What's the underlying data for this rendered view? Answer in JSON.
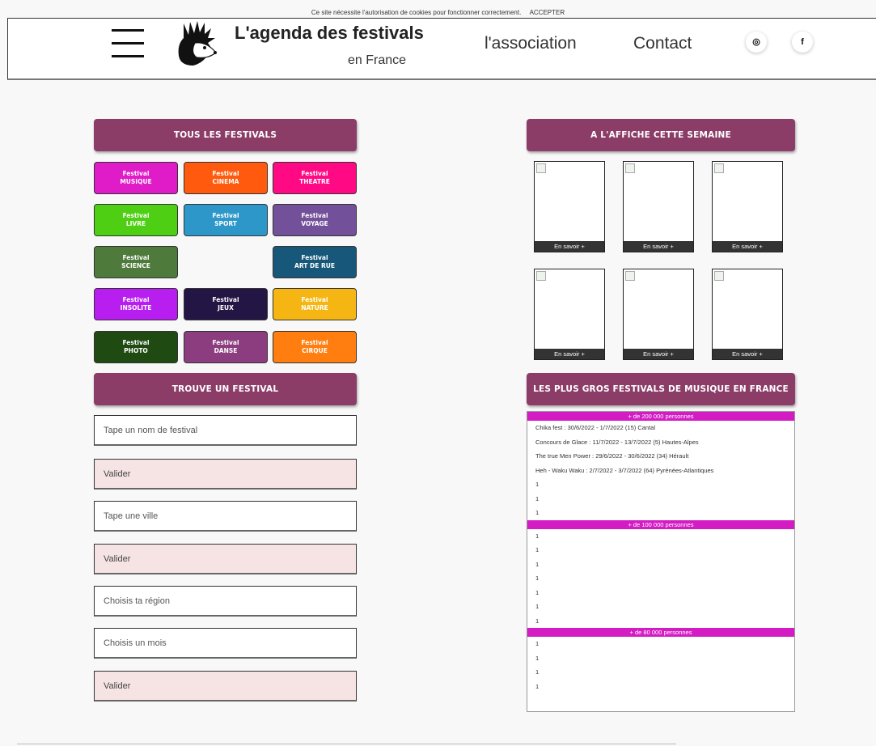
{
  "cookie_bar": {
    "message": "Ce site nécessite l'autorisation de cookies pour fonctionner correctement.",
    "accept_label": "ACCEPTER"
  },
  "header": {
    "title": "L'agenda des festivals",
    "subtitle": "en France",
    "nav": {
      "association": "l'association",
      "contact": "Contact"
    },
    "social": {
      "instagram_glyph": "◎",
      "facebook_glyph": "f"
    }
  },
  "left": {
    "all_festivals_title": "TOUS LES FESTIVALS",
    "categories": [
      {
        "line1": "Festival",
        "line2": "MUSIQUE",
        "color": "#e01bc8"
      },
      {
        "line1": "Festival",
        "line2": "CINEMA",
        "color": "#ff5a0d"
      },
      {
        "line1": "Festival",
        "line2": "THEATRE",
        "color": "#ff0a84"
      },
      {
        "line1": "Festival",
        "line2": "LIVRE",
        "color": "#4fcf14"
      },
      {
        "line1": "Festival",
        "line2": "SPORT",
        "color": "#2e97c9"
      },
      {
        "line1": "Festival",
        "line2": "VOYAGE",
        "color": "#73519a"
      },
      {
        "line1": "Festival",
        "line2": "SCIENCE",
        "color": "#4e7a3b"
      },
      {
        "line1": "Festival",
        "line2": "ART DE RUE",
        "color": "#17587a"
      },
      {
        "line1": "Festival",
        "line2": "INSOLITE",
        "color": "#b71eef"
      },
      {
        "line1": "Festival",
        "line2": "JEUX",
        "color": "#231644"
      },
      {
        "line1": "Festival",
        "line2": "NATURE",
        "color": "#f5b614"
      },
      {
        "line1": "Festival",
        "line2": "PHOTO",
        "color": "#1f4a12"
      },
      {
        "line1": "Festival",
        "line2": "DANSE",
        "color": "#8b3d7f"
      },
      {
        "line1": "Festival",
        "line2": "CIRQUE",
        "color": "#ff7e0f"
      }
    ],
    "find_title": "TROUVE UN FESTIVAL",
    "search_name_placeholder": "Tape un nom de festival",
    "validate_1": "Valider",
    "search_city_placeholder": "Tape une ville",
    "validate_2": "Valider",
    "region_placeholder": "Choisis ta région",
    "month_placeholder": "Choisis un mois",
    "validate_3": "Valider"
  },
  "right": {
    "this_week_title": "A L'AFFICHE CETTE SEMAINE",
    "card_more_label": "En savoir +",
    "cards": [
      {},
      {},
      {},
      {},
      {},
      {}
    ],
    "biggest_title": "LES PLUS GROS FESTIVALS DE MUSIQUE EN FRANCE",
    "tiers": [
      {
        "label": "+ de 200 000 personnes",
        "rows": [
          "Chika fest : 30/6/2022 - 1/7/2022 (15) Cantal",
          "Concours de Glace : 11/7/2022 - 13/7/2022 (5) Hautes-Alpes",
          "The true Men Power : 29/6/2022 - 30/6/2022 (34) Hérault",
          "Heh - Waku Waku : 2/7/2022 - 3/7/2022 (64) Pyrénées-Atlantiques",
          "1",
          "1",
          "1"
        ]
      },
      {
        "label": "+ de 100 000 personnes",
        "rows": [
          "1",
          "1",
          "1",
          "1",
          "1",
          "1",
          "1"
        ]
      },
      {
        "label": "+ de 80 000 personnes",
        "rows": [
          "1",
          "1",
          "1",
          "1"
        ]
      }
    ]
  },
  "colors": {
    "section_header": "#8b3d67",
    "tier_bar": "#d31cc3",
    "validate_bg": "#f6e4e4"
  }
}
